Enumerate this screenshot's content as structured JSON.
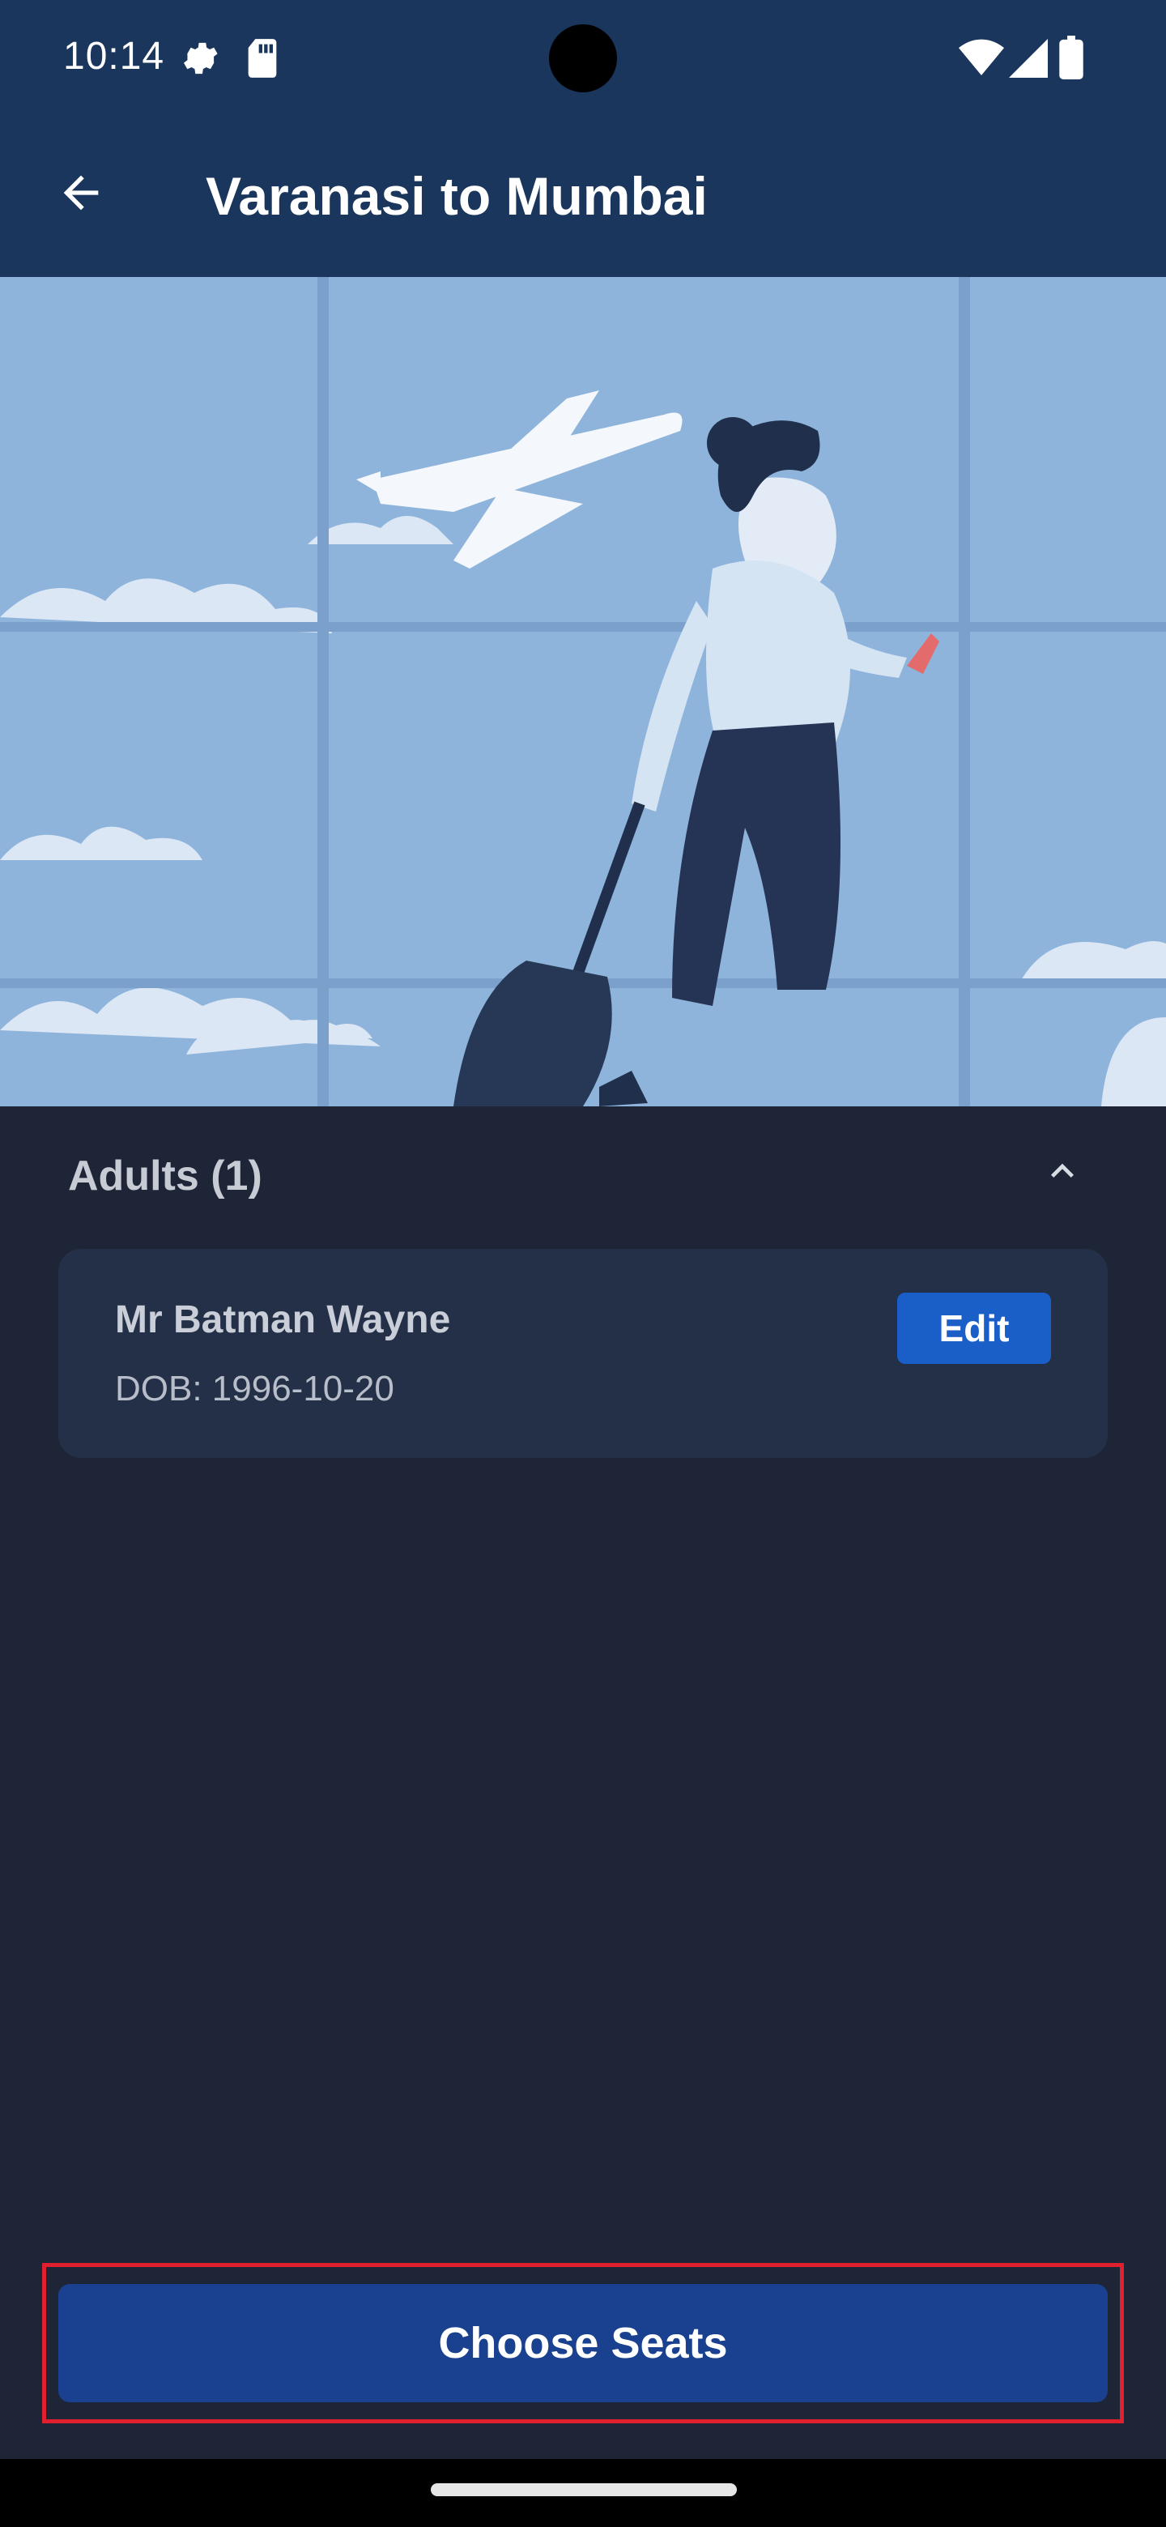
{
  "status_bar": {
    "time": "10:14",
    "icons": [
      "gear-icon",
      "sd-card-icon",
      "wifi-icon",
      "signal-icon",
      "battery-icon"
    ]
  },
  "app_bar": {
    "title": "Varanasi to Mumbai",
    "back_icon": "arrow-left-icon"
  },
  "hero": {
    "illustration": "traveler-with-luggage-airport-window"
  },
  "adults": {
    "header": "Adults (1)",
    "toggle_icon": "chevron-up-icon",
    "passengers": [
      {
        "name": "Mr Batman Wayne",
        "dob": "DOB: 1996-10-20",
        "edit_label": "Edit"
      }
    ]
  },
  "footer": {
    "choose_seats_label": "Choose Seats"
  },
  "colors": {
    "app_bar": "#1b365d",
    "background": "#1e2536",
    "card": "#243047",
    "edit_button": "#1a5fc8",
    "cta": "#1a418f",
    "highlight": "#e0202f"
  }
}
